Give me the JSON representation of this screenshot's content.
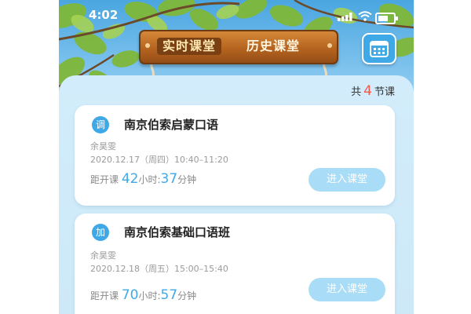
{
  "status_bar": {
    "time": "4:02"
  },
  "tabs": [
    {
      "label": "实时课堂",
      "active": true
    },
    {
      "label": "历史课堂",
      "active": false
    }
  ],
  "calendar_icon": "calendar-icon",
  "summary": {
    "prefix": "共",
    "count": "4",
    "suffix": "节课"
  },
  "courses": [
    {
      "badge": "调",
      "title": "南京伯索启蒙口语",
      "teacher": "余昊雯",
      "datetime": "2020.12.17（周四）10:40–11:20",
      "countdown_prefix": "距开课",
      "hours": "42",
      "hours_unit": "小时:",
      "minutes": "37",
      "minutes_unit": "分钟",
      "enter_label": "进入课堂"
    },
    {
      "badge": "加",
      "title": "南京伯索基础口语班",
      "teacher": "余昊雯",
      "datetime": "2020.12.18（周五）15:00–15:40",
      "countdown_prefix": "距开课",
      "hours": "70",
      "hours_unit": "小时:",
      "minutes": "57",
      "minutes_unit": "分钟",
      "enter_label": "进入课堂"
    }
  ],
  "colors": {
    "accent": "#3fa9e8",
    "count_red": "#f05a4b",
    "button_disabled": "#a9dcf6",
    "sign_wood": "#b5641f"
  }
}
